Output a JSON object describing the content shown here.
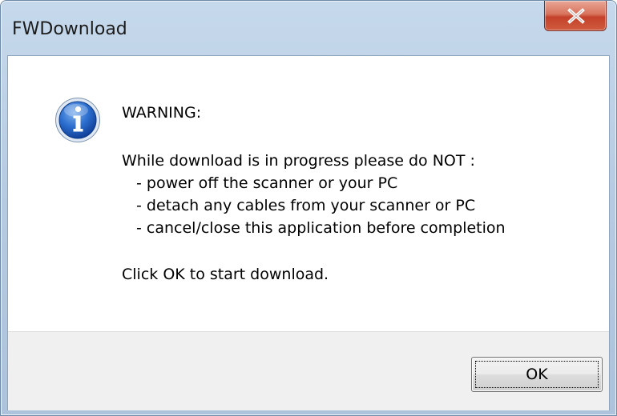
{
  "window": {
    "title": "FWDownload"
  },
  "message": {
    "warning": "WARNING:",
    "body": "While download is in progress please do NOT :",
    "items": [
      "- power off the scanner or your PC",
      "- detach any cables from your scanner or PC",
      "- cancel/close this application before completion"
    ],
    "prompt": "Click OK to start download."
  },
  "buttons": {
    "ok": "OK",
    "close_icon": "close-icon"
  },
  "icons": {
    "message": "info-icon"
  }
}
